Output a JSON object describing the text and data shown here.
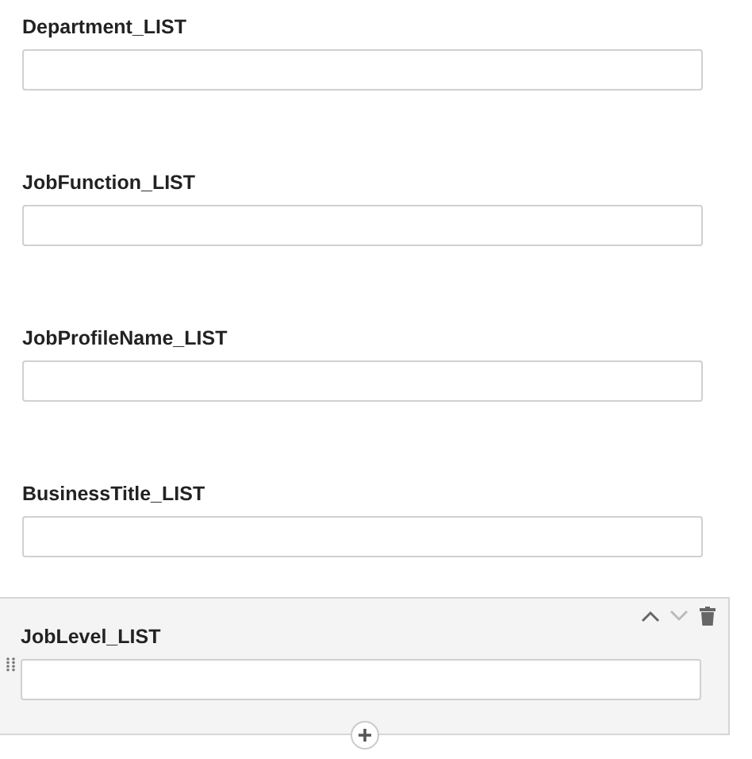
{
  "fields": [
    {
      "label": "Department_LIST",
      "selected": false
    },
    {
      "label": "JobFunction_LIST",
      "selected": false
    },
    {
      "label": "JobProfileName_LIST",
      "selected": false
    },
    {
      "label": "BusinessTitle_LIST",
      "selected": false
    },
    {
      "label": "JobLevel_LIST",
      "selected": true
    }
  ]
}
